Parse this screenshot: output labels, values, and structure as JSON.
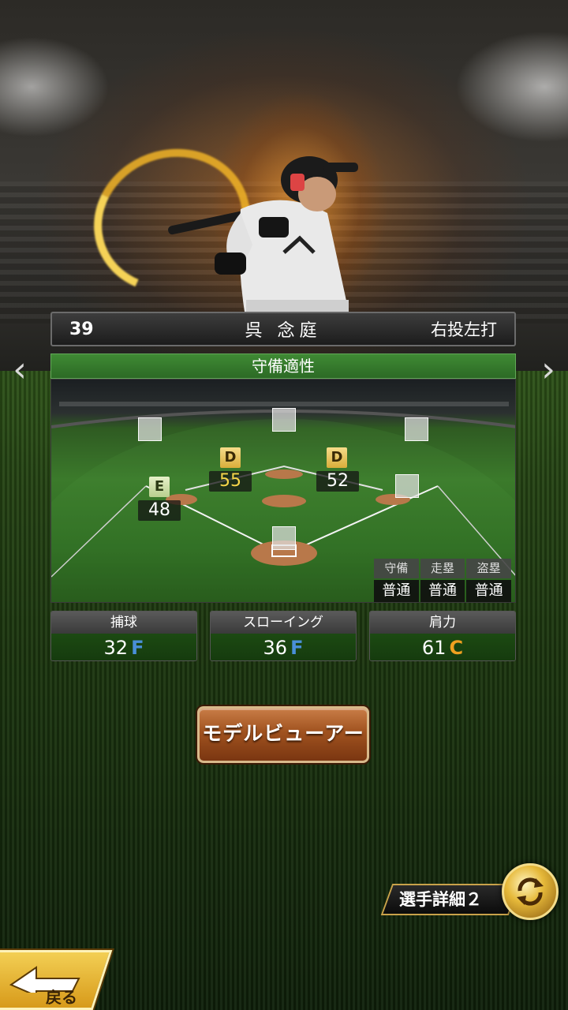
{
  "player": {
    "number": "39",
    "name": "呉 念庭",
    "throw_bat": "右投左打"
  },
  "defense_panel": {
    "title": "守備適性",
    "positions": {
      "second_base": {
        "grade": "D",
        "value": "52"
      },
      "shortstop": {
        "grade": "D",
        "value": "55"
      },
      "third_base": {
        "grade": "E",
        "value": "48"
      }
    },
    "mini_table": {
      "headers": [
        "守備",
        "走塁",
        "盗塁"
      ],
      "values": [
        "普通",
        "普通",
        "普通"
      ]
    }
  },
  "stats": [
    {
      "label": "捕球",
      "value": "32",
      "grade": "F",
      "grade_color": "#4a8fd8"
    },
    {
      "label": "スローイング",
      "value": "36",
      "grade": "F",
      "grade_color": "#4a8fd8"
    },
    {
      "label": "肩力",
      "value": "61",
      "grade": "C",
      "grade_color": "#f0a020"
    }
  ],
  "buttons": {
    "model_viewer": "モデルビューアー",
    "player_detail": "選手詳細２",
    "back": "戻る"
  },
  "icons": {
    "prev": "chevron-left-icon",
    "next": "chevron-right-icon",
    "swap": "swap-arrows-icon",
    "back": "back-arrow-icon"
  }
}
